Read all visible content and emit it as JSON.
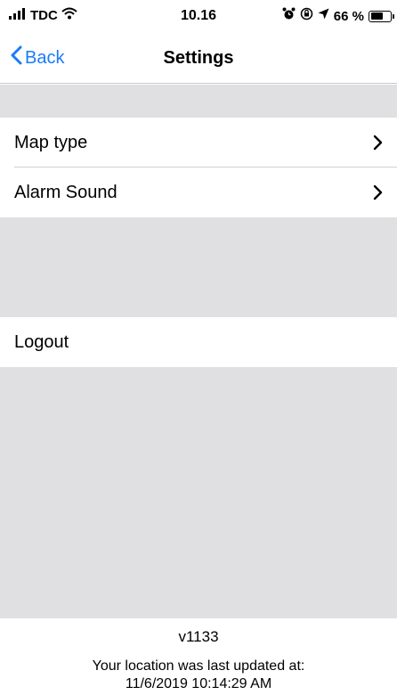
{
  "status_bar": {
    "carrier": "TDC",
    "time": "10.16",
    "battery_percent": "66 %",
    "battery_level": 0.66
  },
  "nav": {
    "back_label": "Back",
    "title": "Settings"
  },
  "settings": {
    "group1": [
      {
        "label": "Map type"
      },
      {
        "label": "Alarm Sound"
      }
    ],
    "group2": [
      {
        "label": "Logout"
      }
    ]
  },
  "footer": {
    "version": "v1133",
    "location_line1": "Your location was last updated at:",
    "location_line2": "11/6/2019 10:14:29 AM"
  },
  "colors": {
    "accent": "#1a7cf6",
    "group_background": "#e0e0e2"
  }
}
